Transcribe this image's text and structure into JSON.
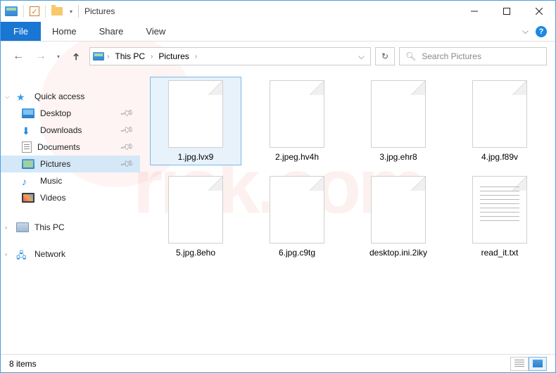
{
  "title": "Pictures",
  "ribbon": {
    "file": "File",
    "tabs": [
      "Home",
      "Share",
      "View"
    ]
  },
  "breadcrumb": {
    "items": [
      "This PC",
      "Pictures"
    ]
  },
  "search": {
    "placeholder": "Search Pictures"
  },
  "sidebar": {
    "quick_access": "Quick access",
    "pinned": [
      {
        "label": "Desktop"
      },
      {
        "label": "Downloads"
      },
      {
        "label": "Documents"
      },
      {
        "label": "Pictures"
      },
      {
        "label": "Music"
      },
      {
        "label": "Videos"
      }
    ],
    "this_pc": "This PC",
    "network": "Network"
  },
  "files": [
    {
      "name": "1.jpg.lvx9",
      "type": "blank",
      "selected": true
    },
    {
      "name": "2.jpeg.hv4h",
      "type": "blank"
    },
    {
      "name": "3.jpg.ehr8",
      "type": "blank"
    },
    {
      "name": "4.jpg.f89v",
      "type": "blank"
    },
    {
      "name": "5.jpg.8eho",
      "type": "blank"
    },
    {
      "name": "6.jpg.c9tg",
      "type": "blank"
    },
    {
      "name": "desktop.ini.2iky",
      "type": "blank"
    },
    {
      "name": "read_it.txt",
      "type": "txt"
    }
  ],
  "status": {
    "count": "8 items"
  }
}
